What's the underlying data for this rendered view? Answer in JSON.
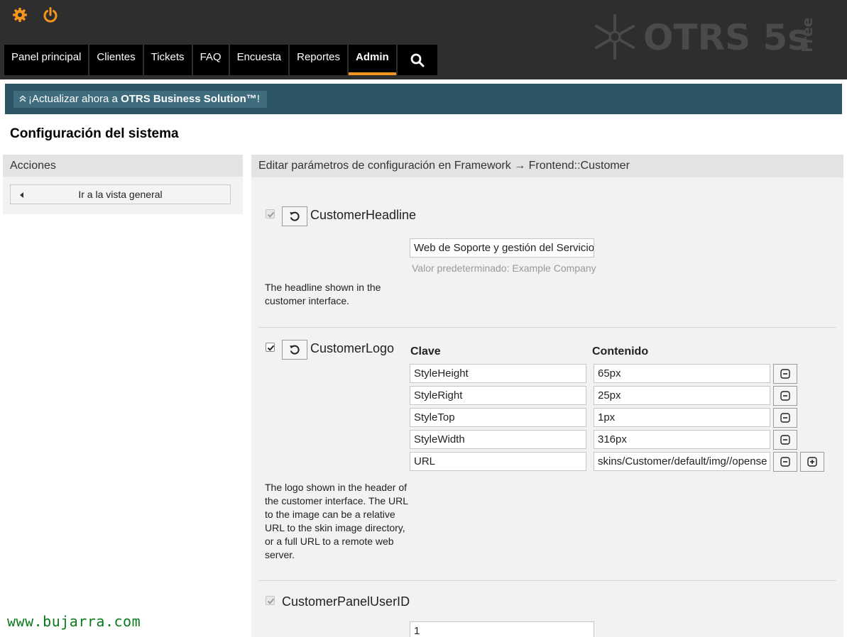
{
  "header": {
    "brand": {
      "name": "OTRS 5s",
      "edition": "Free"
    },
    "nav": [
      "Panel principal",
      "Clientes",
      "Tickets",
      "FAQ",
      "Encuesta",
      "Reportes",
      "Admin"
    ],
    "active_nav": "Admin",
    "accent_color": "#f7941d"
  },
  "banner": {
    "prefix": "¡Actualizar ahora a ",
    "product": "OTRS Business Solution™",
    "suffix": "!"
  },
  "page_title": "Configuración del sistema",
  "sidebar": {
    "title": "Acciones",
    "overview_button": "Ir a la vista general"
  },
  "main": {
    "title": "Editar parámetros de configuración en Framework → Frontend::Customer",
    "headline_setting": {
      "name": "CustomerHeadline",
      "value": "Web de Soporte y gestión del Servicio",
      "default_hint": "Valor predeterminado: Example Company",
      "description": "The headline shown in the customer interface."
    },
    "logo_setting": {
      "name": "CustomerLogo",
      "key_header": "Clave",
      "content_header": "Contenido",
      "rows": [
        {
          "key": "StyleHeight",
          "value": "65px"
        },
        {
          "key": "StyleRight",
          "value": "25px"
        },
        {
          "key": "StyleTop",
          "value": "1px"
        },
        {
          "key": "StyleWidth",
          "value": "316px"
        },
        {
          "key": "URL",
          "value": "skins/Customer/default/img//opense"
        }
      ],
      "description": "The logo shown in the header of the customer interface. The URL to the image can be a relative URL to the skin image directory, or a full URL to a remote web server."
    },
    "panel_user_setting": {
      "name": "CustomerPanelUserID",
      "value": "1"
    }
  },
  "watermark": "www.bujarra.com"
}
